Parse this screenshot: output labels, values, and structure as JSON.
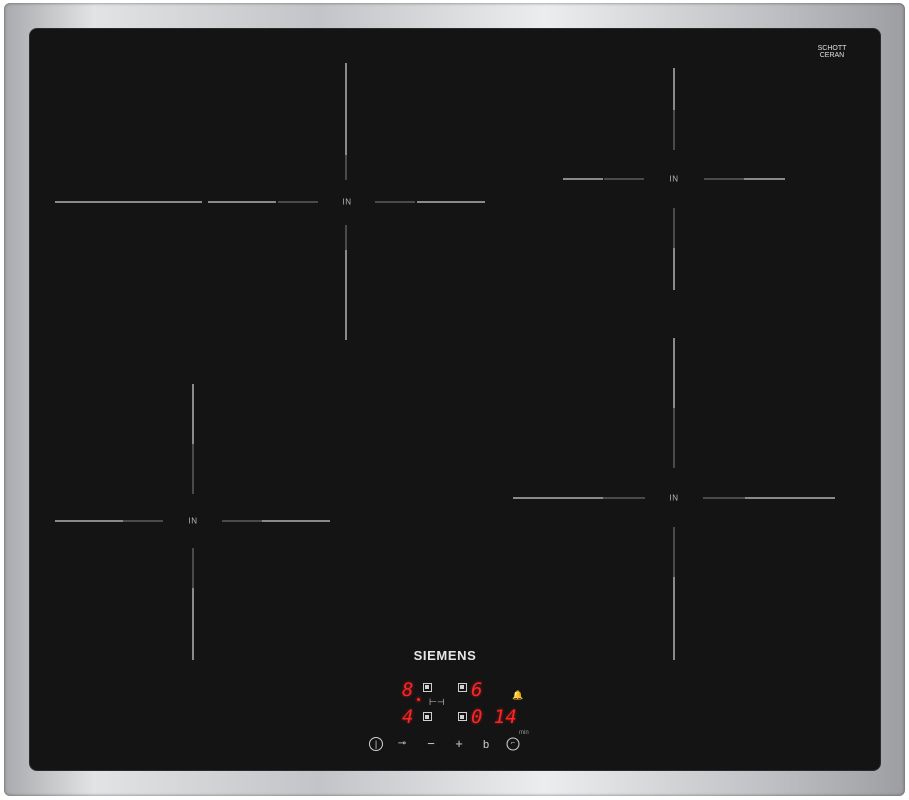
{
  "brand": {
    "name": "SIEMENS",
    "glass_maker_line1": "SCHOTT",
    "glass_maker_line2": "CERAN"
  },
  "zones": [
    {
      "label": "IN"
    },
    {
      "label": "IN"
    },
    {
      "label": "IN"
    },
    {
      "label": "IN"
    }
  ],
  "display": {
    "zone_front_left_level": "8",
    "zone_rear_left_level": "6",
    "zone_front_right_level": "4",
    "timer_value": "0 14",
    "timer_unit": "min"
  },
  "controls": {
    "power_icon": "power-icon",
    "child_lock_icon": "key-icon",
    "minus_label": "−",
    "plus_label": "+",
    "boost_label": "b",
    "timer_icon": "clock-icon",
    "alarm_icon": "bell-icon"
  },
  "colors": {
    "glass": "#141414",
    "frame": "#c3c4c7",
    "display_red": "#ff2424",
    "markings": "#8a8a8a"
  }
}
